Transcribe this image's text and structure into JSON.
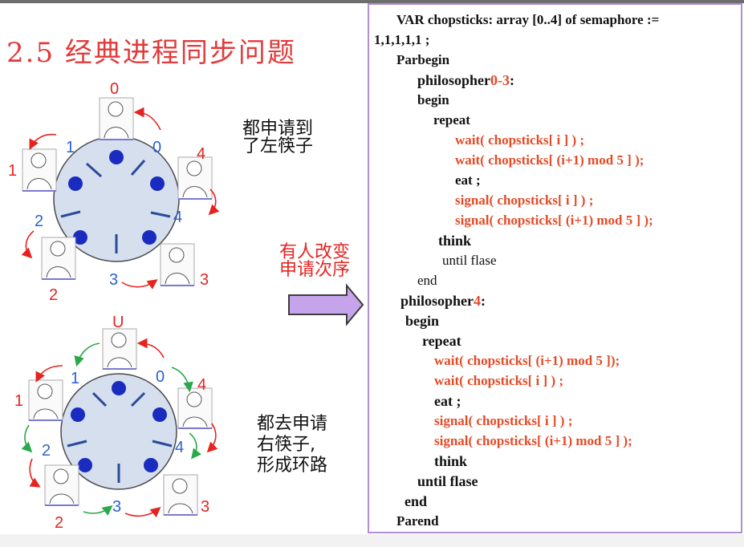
{
  "title": "2.5 经典进程同步问题",
  "diagram_top": {
    "labels_black": [
      "0",
      "1",
      "2",
      "3",
      "4"
    ],
    "labels_blue": [
      "0",
      "1",
      "2",
      "3",
      "4"
    ],
    "note": "都申请到\n了左筷子"
  },
  "middle_note": "有人改变\n申请次序",
  "diagram_bottom": {
    "label_top": "U",
    "labels_black": [
      "1",
      "2",
      "3",
      "4"
    ],
    "labels_blue": [
      "0",
      "1",
      "2",
      "3",
      "4"
    ],
    "note": "都去申请\n右筷子,\n形成环路"
  },
  "code": {
    "l1": "VAR chopsticks: array [0..4] of semaphore :=",
    "l2": "1,1,1,1,1 ;",
    "l3": "Parbegin",
    "l4a": "philosopher",
    "l4b": "0-3",
    "l4c": ":",
    "l5": "begin",
    "l6": "repeat",
    "l7": "wait( chopsticks[ i ] ) ;",
    "l8": "wait( chopsticks[ (i+1) mod 5 ] );",
    "l9": "eat ;",
    "l10": "signal( chopsticks[ i ] ) ;",
    "l11": "signal( chopsticks[ (i+1) mod 5 ] );",
    "l12": "think",
    "l13": "until flase",
    "l14": "end",
    "l15a": "philosopher",
    "l15b": "4",
    "l15c": ":",
    "l16": "begin",
    "l17": "repeat",
    "l18": "wait( chopsticks[ (i+1) mod 5 ]);",
    "l19": "wait( chopsticks[ i ] ) ;",
    "l20": "eat ;",
    "l21": "signal( chopsticks[ i ] ) ;",
    "l22": "signal( chopsticks[ (i+1) mod 5 ] );",
    "l23": "think",
    "l24": "until flase",
    "l25": "end",
    "l26": "Parend"
  },
  "colors": {
    "red": "#e52420",
    "blue": "#2a62d4",
    "green": "#2aa84a",
    "dot": "#1a2bc0",
    "border": "#b28fd4"
  }
}
